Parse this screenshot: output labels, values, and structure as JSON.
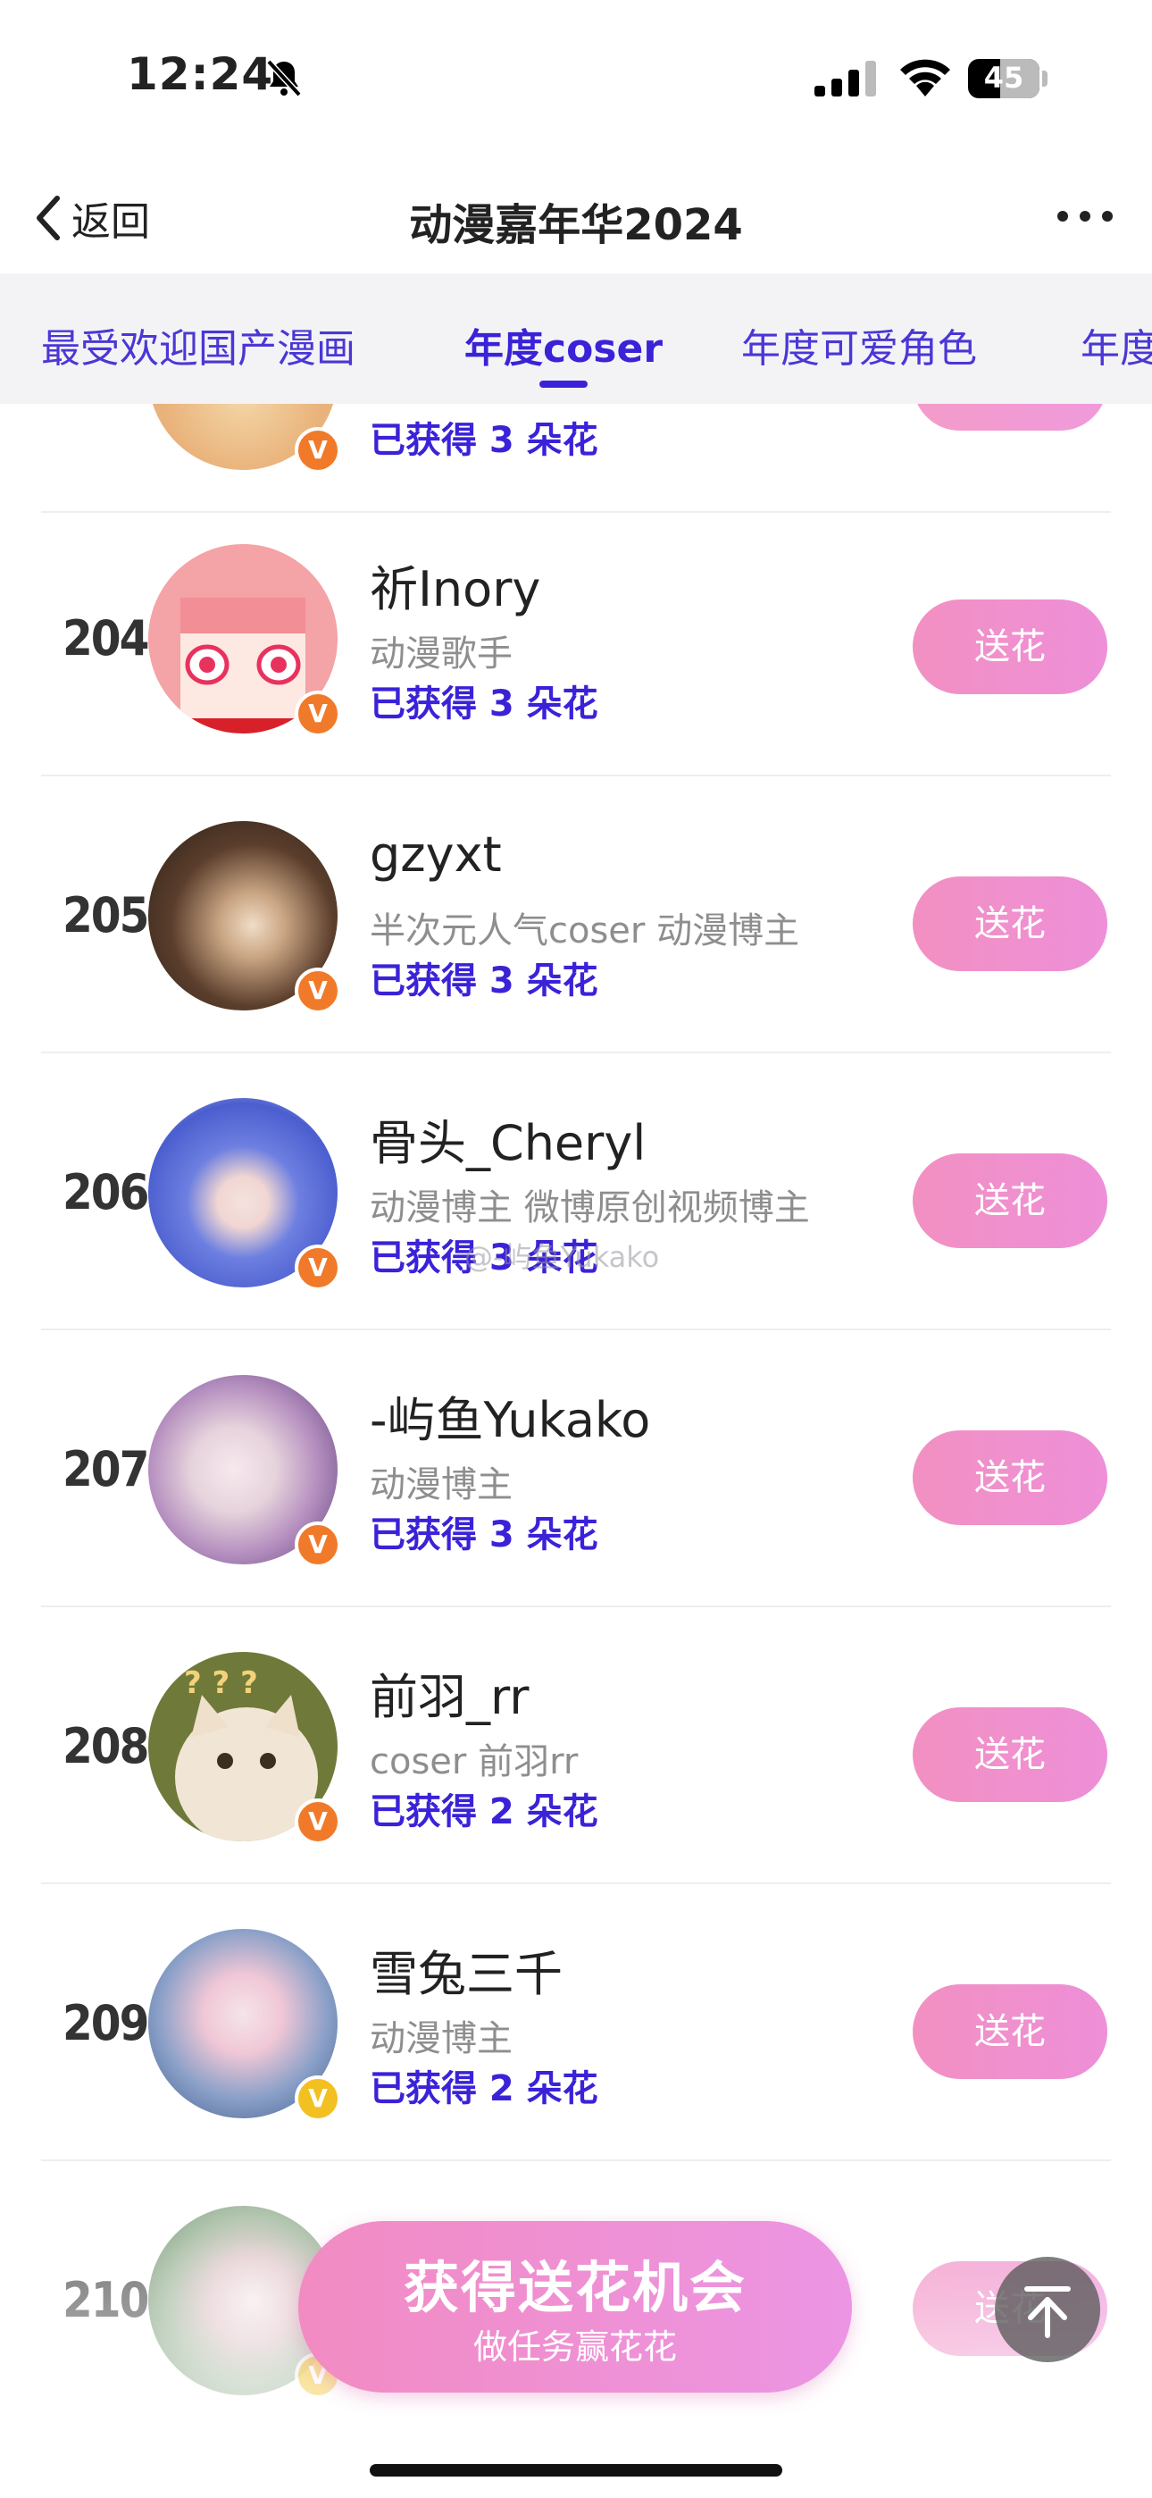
{
  "status_bar": {
    "time": "12:24",
    "battery": "45",
    "battery_level": 0.45
  },
  "header": {
    "back_label": "返回",
    "title": "动漫嘉年华2024"
  },
  "tabs": [
    {
      "label": "最受欢迎国产漫画",
      "active": false
    },
    {
      "label": "年度coser",
      "active": true
    },
    {
      "label": "年度可爱角色",
      "active": false
    },
    {
      "label": "年度",
      "active": false
    }
  ],
  "partial_top_row": {
    "flowers": "已获得 3 朵花"
  },
  "entries": [
    {
      "rank": "204",
      "name": "祈Inory",
      "description": "动漫歌手",
      "flowers": "已获得 3 朵花",
      "button": "送花",
      "badge": "V",
      "badge_color": "#f07a2a"
    },
    {
      "rank": "205",
      "name": "gzyxt",
      "description": "半次元人气coser 动漫博主",
      "flowers": "已获得 3 朵花",
      "button": "送花",
      "badge": "V",
      "badge_color": "#f07a2a"
    },
    {
      "rank": "206",
      "name": "骨头_Cheryl",
      "description": "动漫博主 微博原创视频博主",
      "flowers": "已获得 3 朵花",
      "button": "送花",
      "badge": "V",
      "badge_color": "#f07a2a"
    },
    {
      "rank": "207",
      "name": "-屿鱼Yukako",
      "description": "动漫博主",
      "flowers": "已获得 3 朵花",
      "button": "送花",
      "badge": "V",
      "badge_color": "#f07a2a"
    },
    {
      "rank": "208",
      "name": "前羽_rr",
      "description": "coser 前羽rr",
      "flowers": "已获得 2 朵花",
      "button": "送花",
      "badge": "V",
      "badge_color": "#f07a2a"
    },
    {
      "rank": "209",
      "name": "雪兔三千",
      "description": "动漫博主",
      "flowers": "已获得 2 朵花",
      "button": "送花",
      "badge": "V",
      "badge_color": "#f2c021"
    },
    {
      "rank": "210",
      "name": "",
      "description": "",
      "flowers": "",
      "button": "送花",
      "badge": "V",
      "badge_color": "#f2c021"
    }
  ],
  "cta": {
    "title": "获得送花机会",
    "subtitle": "做任务赢花花"
  },
  "watermark": "@-屿鱼Yukako",
  "colors": {
    "accent": "#3a22d8",
    "button_pink": "#f290c2"
  }
}
